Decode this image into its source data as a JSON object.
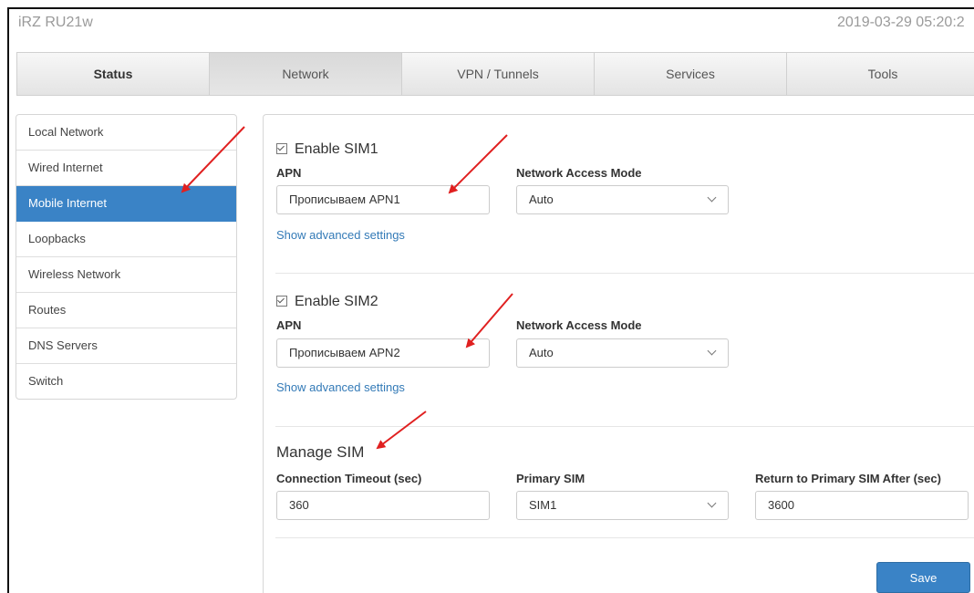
{
  "header": {
    "device": "iRZ RU21w",
    "datetime": "2019-03-29 05:20:2"
  },
  "tabs": [
    {
      "label": "Status"
    },
    {
      "label": "Network",
      "active": true
    },
    {
      "label": "VPN / Tunnels"
    },
    {
      "label": "Services"
    },
    {
      "label": "Tools"
    }
  ],
  "sidebar": {
    "items": [
      {
        "label": "Local Network"
      },
      {
        "label": "Wired Internet"
      },
      {
        "label": "Mobile Internet",
        "active": true
      },
      {
        "label": "Loopbacks"
      },
      {
        "label": "Wireless Network"
      },
      {
        "label": "Routes"
      },
      {
        "label": "DNS Servers"
      },
      {
        "label": "Switch"
      }
    ]
  },
  "sim1": {
    "enable_label": "Enable SIM1",
    "enabled": true,
    "apn_label": "APN",
    "apn_value": "Прописываем APN1",
    "mode_label": "Network Access Mode",
    "mode_value": "Auto",
    "advanced_link": "Show advanced settings"
  },
  "sim2": {
    "enable_label": "Enable SIM2",
    "enabled": true,
    "apn_label": "APN",
    "apn_value": "Прописываем APN2",
    "mode_label": "Network Access Mode",
    "mode_value": "Auto",
    "advanced_link": "Show advanced settings"
  },
  "manage": {
    "title": "Manage SIM",
    "timeout_label": "Connection Timeout (sec)",
    "timeout_value": "360",
    "primary_label": "Primary SIM",
    "primary_value": "SIM1",
    "return_label": "Return to Primary SIM After (sec)",
    "return_value": "3600"
  },
  "actions": {
    "save_label": "Save"
  },
  "colors": {
    "accent": "#3a83c6",
    "link": "#337ab7",
    "annotation_arrow": "#e02020"
  }
}
